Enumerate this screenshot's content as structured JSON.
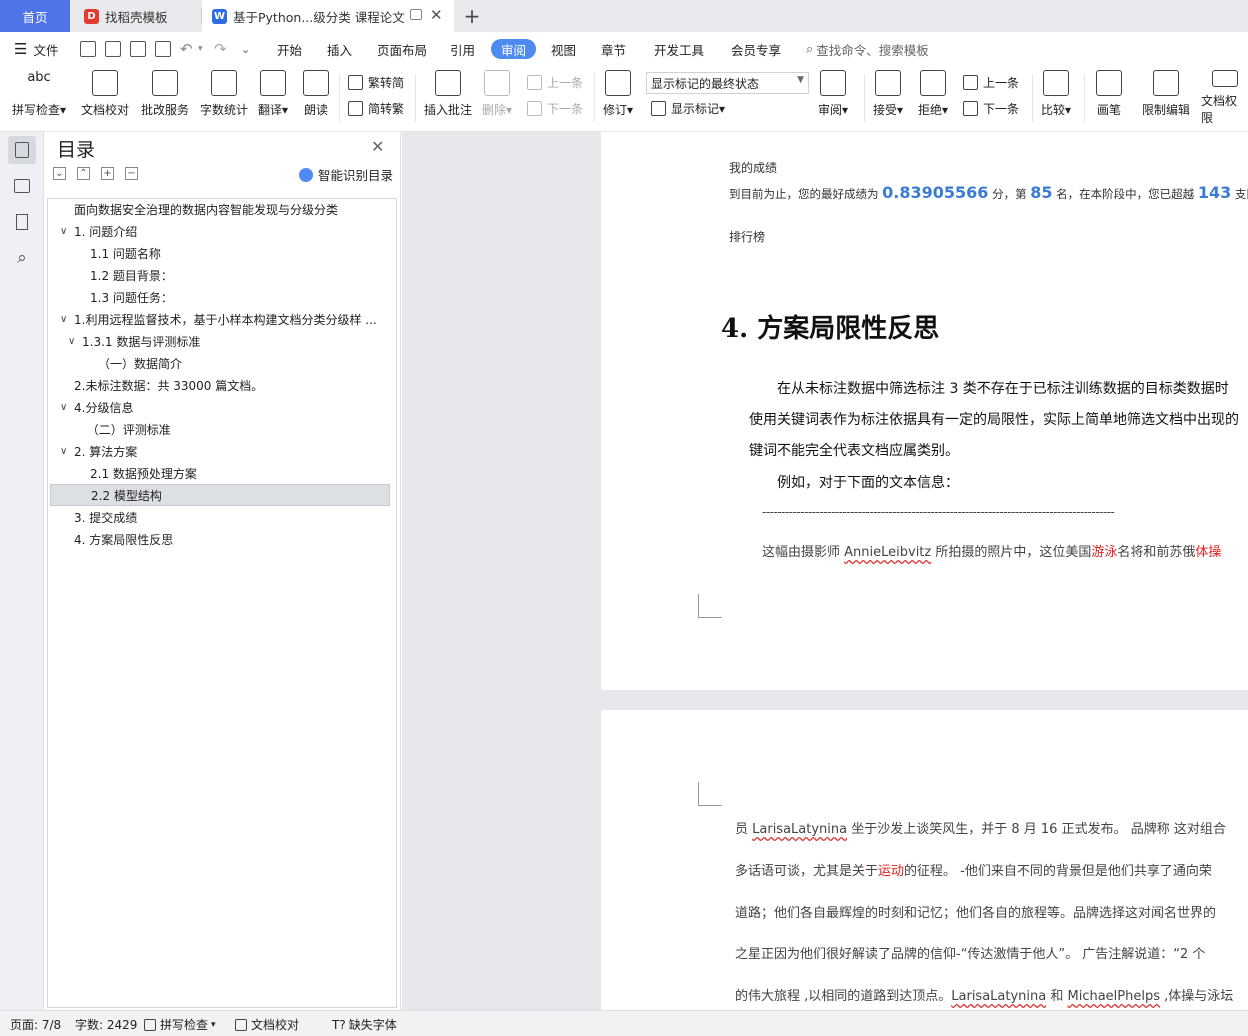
{
  "tabs": {
    "home": "首页",
    "template": "找稻壳模板",
    "document": "基于Python...级分类 课程论文"
  },
  "menu": {
    "file": "文件",
    "items": [
      "开始",
      "插入",
      "页面布局",
      "引用",
      "审阅",
      "视图",
      "章节",
      "开发工具",
      "会员专享"
    ],
    "active": "审阅",
    "search_placeholder": "查找命令、搜索模板"
  },
  "ribbon": {
    "spell": "拼写检查",
    "doc_check": "文档校对",
    "batch_service": "批改服务",
    "word_count": "字数统计",
    "translate": "翻译",
    "read_aloud": "朗读",
    "to_simplified": "繁转简",
    "to_traditional": "简转繁",
    "insert_comment": "插入批注",
    "delete": "删除",
    "prev": "上一条",
    "next": "下一条",
    "track": "修订",
    "markup_state": "显示标记的最终状态",
    "show_markup": "显示标记",
    "review": "审阅",
    "accept": "接受",
    "reject": "拒绝",
    "change_prev": "上一条",
    "change_next": "下一条",
    "compare": "比较",
    "pen": "画笔",
    "restrict": "限制编辑",
    "doc_perm": "文档权限"
  },
  "toc": {
    "title": "目录",
    "smart": "智能识别目录",
    "items": [
      {
        "text": "面向数据安全治理的数据内容智能发现与分级分类",
        "indent": 0,
        "chev": ""
      },
      {
        "text": "1. 问题介绍",
        "indent": 0,
        "chev": "∨"
      },
      {
        "text": "1.1 问题名称",
        "indent": 2,
        "chev": ""
      },
      {
        "text": "1.2 题目背景：",
        "indent": 2,
        "chev": ""
      },
      {
        "text": "1.3 问题任务：",
        "indent": 2,
        "chev": ""
      },
      {
        "text": "1.利用远程监督技术，基于小样本构建文档分类分级样 ...",
        "indent": 0,
        "chev": "∨"
      },
      {
        "text": "1.3.1 数据与评测标准",
        "indent": 1,
        "chev": "∨"
      },
      {
        "text": "（一）数据简介",
        "indent": 3,
        "chev": ""
      },
      {
        "text": "2.未标注数据：共 33000 篇文档。",
        "indent": 0,
        "chev": ""
      },
      {
        "text": "4.分级信息",
        "indent": 0,
        "chev": "∨"
      },
      {
        "text": "（二）评测标准",
        "indent": 1.6,
        "chev": ""
      },
      {
        "text": "2. 算法方案",
        "indent": 0,
        "chev": "∨"
      },
      {
        "text": "2.1 数据预处理方案",
        "indent": 2,
        "chev": ""
      },
      {
        "text": "2.2 模型结构",
        "indent": 2,
        "chev": ""
      },
      {
        "text": "3. 提交成绩",
        "indent": 0,
        "chev": ""
      },
      {
        "text": "4. 方案局限性反思",
        "indent": 0,
        "chev": ""
      }
    ],
    "selected_index": 13
  },
  "doc": {
    "score_title": "我的成绩",
    "score_prefix": "到目前为止，您的最好成绩为",
    "score": "0.83905566",
    "score_unit": "分，第",
    "rank": "85",
    "rank_unit": "名，在本阶段中，您已超越",
    "beaten": "143",
    "beaten_unit": "支队伍。",
    "leaderboard": "排行榜",
    "heading": "4.  方案局限性反思",
    "p1": "在从未标注数据中筛选标注 3 类不存在于已标注训练数据的目标类数据时",
    "p2": "使用关键词表作为标注依据具有一定的局限性，实际上简单地筛选文档中出现的",
    "p3": "键词不能完全代表文档应属类别。",
    "p4": "例如，对于下面的文本信息：",
    "dashes": "--------------------------------------------------------------------------------------------",
    "q1a": "这幅由摄影师 ",
    "q1b": "AnnieLeibvitz",
    "q1c": " 所拍摄的照片中，这位美国",
    "q1d": "游泳",
    "q1e": "名将和前苏俄",
    "q1f": "体操",
    "p2l1a": "员 ",
    "p2l1b": "LarisaLatynina",
    "p2l1c": " 坐于沙发上谈笑风生，并于 8 月 16 正式发布。   品牌称  这对组合",
    "p2l2a": "多话语可谈，尤其是关于",
    "p2l2b": "运动",
    "p2l2c": "的征程。 -他们来自不同的背景但是他们共享了通向荣",
    "p2l3": "道路；他们各自最辉煌的时刻和记忆；他们各自的旅程等。品牌选择这对闻名世界的",
    "p2l4": "之星正因为他们很好解读了品牌的信仰-“传达激情于他人”。   广告注解说道：“2 个",
    "p2l5a": "的伟大旅程 ,以相同的道路到达顶点。",
    "p2l5b": "LarisaLatynina",
    "p2l5c": " 和 ",
    "p2l5d": "MichaelPhelps",
    "p2l5e": " ,体操与泳坛"
  },
  "status": {
    "page": "页面: 7/8",
    "words": "字数: 2429",
    "spell": "拼写检查",
    "proof": "文档校对",
    "missing_font": "缺失字体"
  },
  "colors": {
    "accent": "#4e74e8",
    "link_blue": "#3b7bd6",
    "red": "#e02020"
  }
}
